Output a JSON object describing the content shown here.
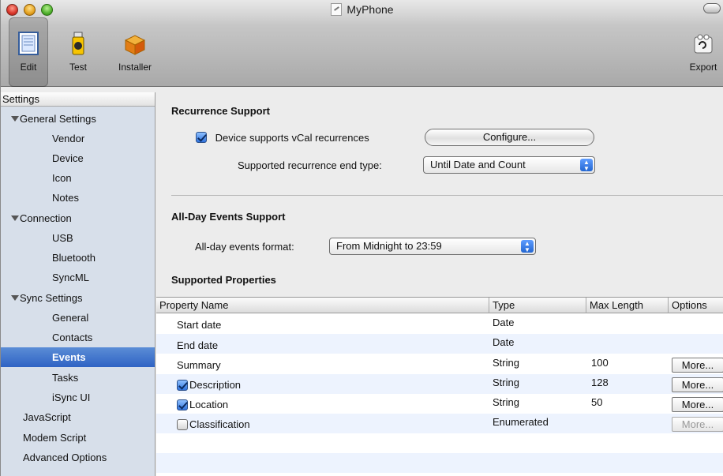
{
  "window": {
    "title": "MyPhone"
  },
  "toolbar": {
    "edit": "Edit",
    "test": "Test",
    "installer": "Installer",
    "export": "Export"
  },
  "sidebar": {
    "header": "Settings",
    "items": [
      {
        "label": "General Settings",
        "type": "group"
      },
      {
        "label": "Vendor"
      },
      {
        "label": "Device"
      },
      {
        "label": "Icon"
      },
      {
        "label": "Notes"
      },
      {
        "label": "Connection",
        "type": "group"
      },
      {
        "label": "USB"
      },
      {
        "label": "Bluetooth"
      },
      {
        "label": "SyncML"
      },
      {
        "label": "Sync Settings",
        "type": "group"
      },
      {
        "label": "General"
      },
      {
        "label": "Contacts"
      },
      {
        "label": "Events",
        "selected": true
      },
      {
        "label": "Tasks"
      },
      {
        "label": "iSync UI"
      },
      {
        "label": "JavaScript"
      },
      {
        "label": "Modem Script"
      },
      {
        "label": "Advanced Options"
      }
    ]
  },
  "recurrence": {
    "title": "Recurrence Support",
    "checkbox_label": "Device supports vCal recurrences",
    "checkbox_checked": true,
    "configure_button": "Configure...",
    "end_type_label": "Supported recurrence end type:",
    "end_type_value": "Until Date and Count"
  },
  "allday": {
    "title": "All-Day Events Support",
    "format_label": "All-day events format:",
    "format_value": "From Midnight to 23:59"
  },
  "properties": {
    "title": "Supported Properties",
    "columns": [
      "Property Name",
      "Type",
      "Max Length",
      "Options"
    ],
    "rows": [
      {
        "name": "Start date",
        "type": "Date",
        "max": "",
        "checkbox": false,
        "more": ""
      },
      {
        "name": "End date",
        "type": "Date",
        "max": "",
        "checkbox": false,
        "more": ""
      },
      {
        "name": "Summary",
        "type": "String",
        "max": "100",
        "checkbox": false,
        "more": "More..."
      },
      {
        "name": "Description",
        "type": "String",
        "max": "128",
        "checkbox": true,
        "checked": true,
        "more": "More..."
      },
      {
        "name": "Location",
        "type": "String",
        "max": "50",
        "checkbox": true,
        "checked": true,
        "more": "More..."
      },
      {
        "name": "Classification",
        "type": "Enumerated",
        "max": "",
        "checkbox": true,
        "checked": false,
        "more": "More...",
        "more_disabled": true
      }
    ]
  },
  "colors": {
    "selection": "#2f63c4",
    "row_alt": "#edf3fe",
    "accent": "#3f7fe0"
  }
}
